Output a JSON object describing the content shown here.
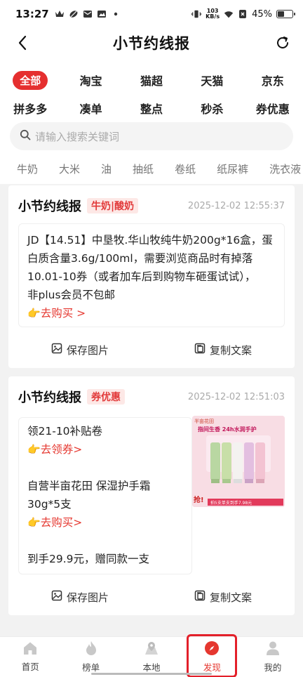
{
  "status_bar": {
    "time": "13:27",
    "net_speed_value": "103",
    "net_speed_unit": "KB/s",
    "battery": "45%",
    "battery_level": 0.45,
    "icons": [
      "crown-icon",
      "leaf-icon",
      "mail-icon",
      "image-icon",
      "dot-icon",
      "vibrate-icon",
      "wifi-icon",
      "close-box-icon",
      "battery-icon"
    ]
  },
  "nav": {
    "title": "小节约线报",
    "back_icon": "chevron-left-icon",
    "refresh_icon": "refresh-icon"
  },
  "categories": [
    [
      "全部",
      "淘宝",
      "猫超",
      "天猫",
      "京东"
    ],
    [
      "拼多多",
      "凑单",
      "整点",
      "秒杀",
      "券优惠"
    ]
  ],
  "active_category": "全部",
  "search": {
    "placeholder": "请输入搜索关键词",
    "icon": "search-icon"
  },
  "tags": [
    "牛奶",
    "大米",
    "油",
    "抽纸",
    "卷纸",
    "纸尿裤",
    "洗衣液"
  ],
  "cards": [
    {
      "brand": "小节约线报",
      "tag": "牛奶|酸奶",
      "time": "2025-12-02 12:55:37",
      "lines": [
        "JD【14.51】中垦牧.华山牧纯牛奶200g*16盒，蛋",
        "白质含量3.6g/100ml，需要浏览商品时有掉落",
        "10.01-10券（或者加车后到购物车砸蛋试试），",
        "非plus会员不包邮"
      ],
      "link": "去购买 >",
      "save_label": "保存图片",
      "copy_label": "复制文案"
    },
    {
      "brand": "小节约线报",
      "tag": "券优惠",
      "time": "2025-12-02 12:51:03",
      "line1": "领21-10补贴卷",
      "link1": "去领券>",
      "line2a": "自营半亩花田 保湿护手霜",
      "line2b": "30g*5支",
      "link2": "去购买>",
      "line3": "到手29.9元，赠同款一支",
      "save_label": "保存图片",
      "copy_label": "复制文案",
      "image": {
        "brand_text": "半亩花田",
        "headline": "指间生香 24h水润手护",
        "corner_text": "抢!",
        "badge_text": "拍5支单支到手7.98元"
      }
    }
  ],
  "tabs": [
    {
      "label": "首页",
      "icon": "home-icon"
    },
    {
      "label": "榜单",
      "icon": "flame-icon"
    },
    {
      "label": "本地",
      "icon": "map-pin-icon"
    },
    {
      "label": "发现",
      "icon": "compass-icon"
    },
    {
      "label": "我的",
      "icon": "user-icon"
    }
  ],
  "active_tab": "发现",
  "colors": {
    "accent": "#e5372f",
    "tag_bg": "#fde8e6",
    "page_bg": "#f2f2f2"
  }
}
